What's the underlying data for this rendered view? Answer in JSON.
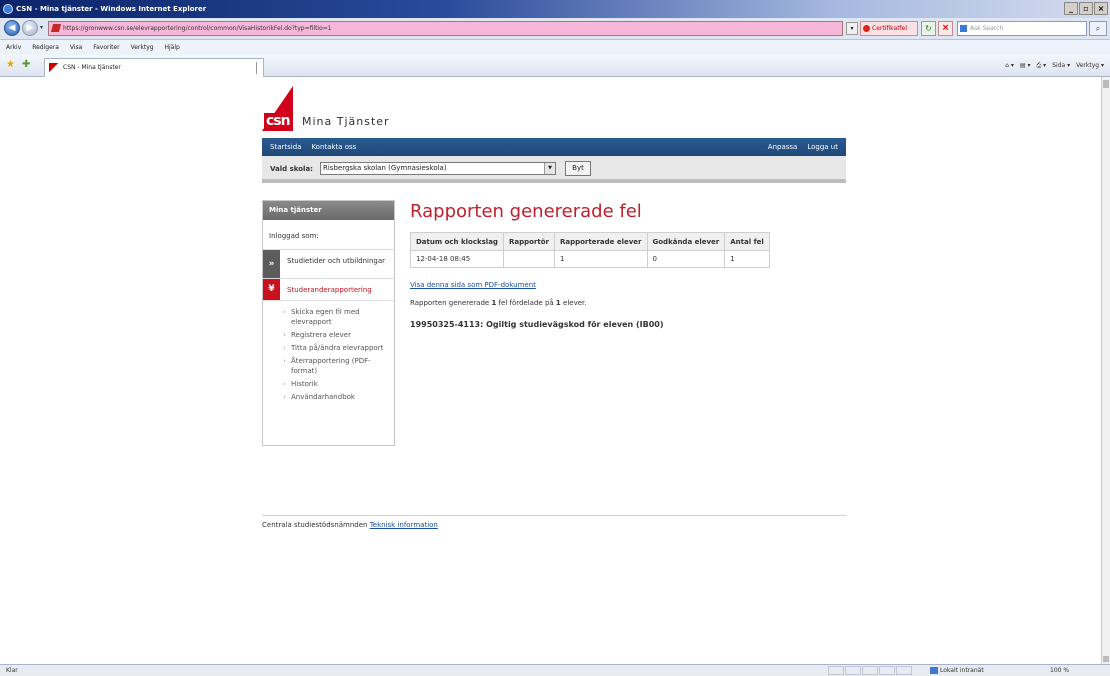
{
  "browser": {
    "window_title": "CSN - Mina tjänster - Windows Internet Explorer",
    "url": "https://gronwww.csn.se/elevrapportering/control/common/VisaHistorikFel.do?typ=filtio=1",
    "cert_label": "Certifikatfel",
    "search_placeholder": "Ask Search",
    "menu": [
      "Arkiv",
      "Redigera",
      "Visa",
      "Favoriter",
      "Verktyg",
      "Hjälp"
    ],
    "tab_title": "CSN - Mina tjänster",
    "cmd": {
      "home": "⌂ ▾",
      "feeds": "▤ ▾",
      "print": "⎙ ▾",
      "page": "Sida ▾",
      "tools": "Verktyg ▾"
    },
    "status_text": "Klar",
    "zone": "Lokalt intranät",
    "zoom": "100 %"
  },
  "site": {
    "logo_mark": "csn",
    "logo_text": "Mina Tjänster",
    "nav_left": [
      "Startsida",
      "Kontakta oss"
    ],
    "nav_right": [
      "Anpassa",
      "Logga ut"
    ],
    "school_label": "Vald skola:",
    "school_value": "Risbergska skolan (Gymnasieskola)",
    "change_button": "Byt"
  },
  "sidebar": {
    "header": "Mina tjänster",
    "logged_in": "Inloggad som:",
    "items": [
      {
        "label": "Studietider och utbildningar",
        "icon": "»"
      },
      {
        "label": "Studeranderapportering",
        "icon": "¥"
      }
    ],
    "subitems": [
      "Skicka egen fil med elevrapport",
      "Registrera elever",
      "Titta på/ändra elevrapport",
      "Återrapportering (PDF-format)",
      "Historik",
      "Användarhandbok"
    ]
  },
  "main": {
    "title": "Rapporten genererade fel",
    "table": {
      "headers": [
        "Datum och klockslag",
        "Rapportör",
        "Rapporterade elever",
        "Godkända elever",
        "Antal fel"
      ],
      "rows": [
        [
          "12-04-18 08:45",
          "",
          "1",
          "0",
          "1"
        ]
      ]
    },
    "pdf_link": "Visa denna sida som PDF-dokument",
    "summary_pre": "Rapporten genererade",
    "summary_errors": "1",
    "summary_mid": "fel fördelade på",
    "summary_students": "1",
    "summary_post": "elever.",
    "error_line": "19950325-4113: Ogiltig studievägskod för eleven (IB00)"
  },
  "footer": {
    "org": "Centrala studiestödsnämnden",
    "link": "Teknisk information"
  }
}
